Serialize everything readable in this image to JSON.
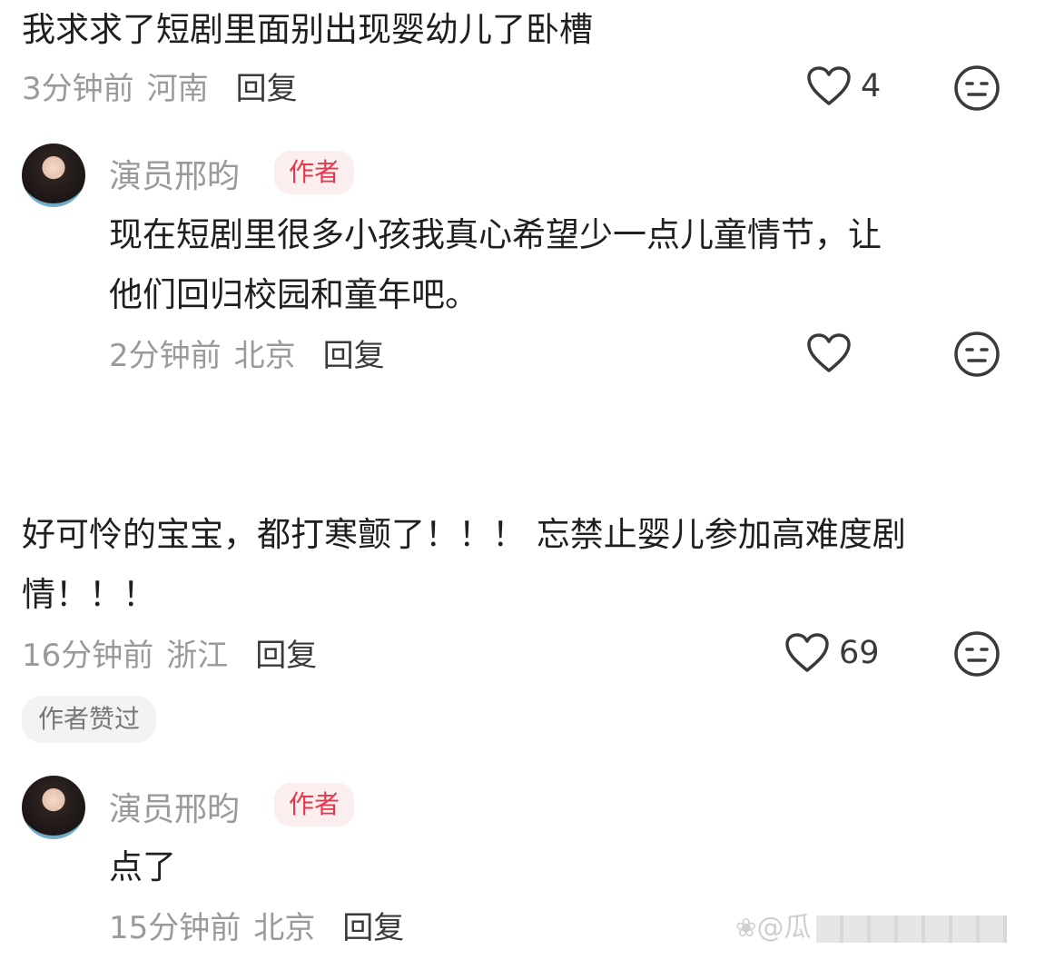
{
  "comments": [
    {
      "text": "我求求了短剧里面别出现婴幼儿了卧槽",
      "time": "3分钟前",
      "location": "河南",
      "reply_label": "回复",
      "likes": "4",
      "reply": {
        "author": "演员邢昀",
        "tag": "作者",
        "text_line1": "现在短剧里很多小孩我真心希望少一点儿童情节，让",
        "text_line2": "他们回归校园和童年吧。",
        "time": "2分钟前",
        "location": "北京",
        "reply_label": "回复"
      }
    },
    {
      "text_line1": "好可怜的宝宝，都打寒颤了！！！ 忘禁止婴儿参加高难度剧",
      "text_line2": "情！！！",
      "time": "16分钟前",
      "location": "浙江",
      "reply_label": "回复",
      "likes": "69",
      "liked_by_author": "作者赞过",
      "reply": {
        "author": "演员邢昀",
        "tag": "作者",
        "text": "点了",
        "time": "15分钟前",
        "location": "北京",
        "reply_label": "回复"
      }
    }
  ],
  "watermark": "@瓜",
  "icons": [
    "heart-outline-icon",
    "neutral-face-icon",
    "avatar-image"
  ]
}
